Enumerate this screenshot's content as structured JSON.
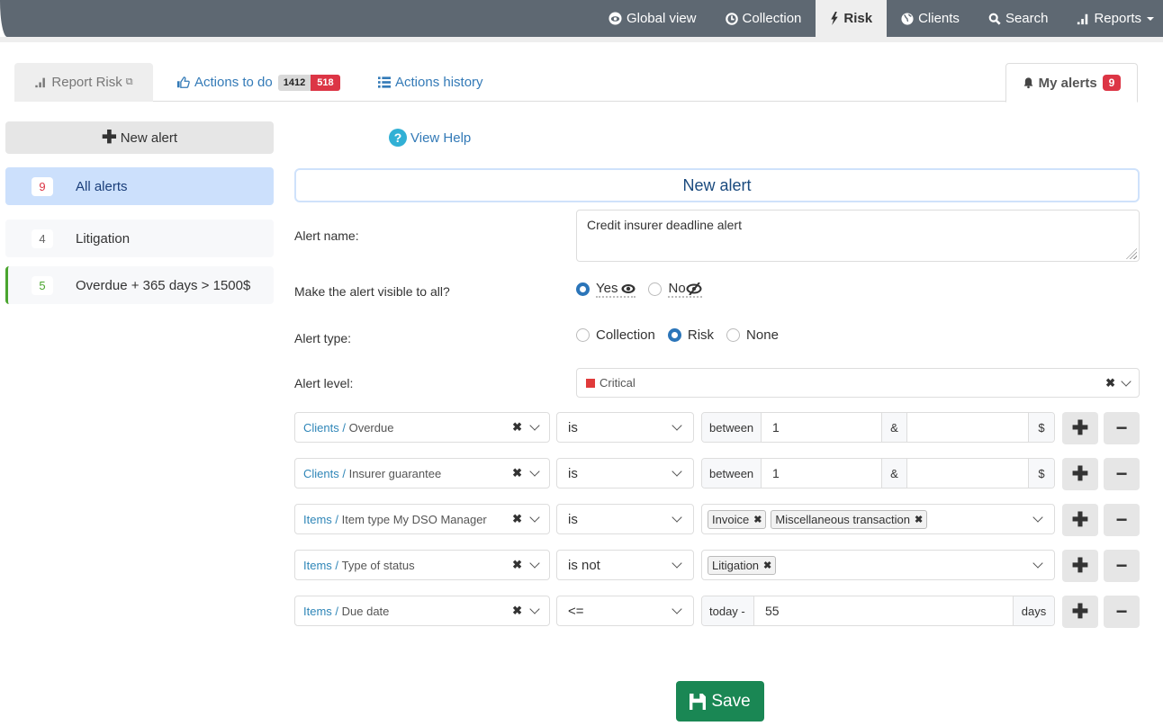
{
  "nav": {
    "items": [
      {
        "label": "Global view",
        "icon": "eye-icon"
      },
      {
        "label": "Collection",
        "icon": "clock-icon"
      },
      {
        "label": "Risk",
        "icon": "bolt-icon",
        "active": true
      },
      {
        "label": "Clients",
        "icon": "globe-icon"
      },
      {
        "label": "Search",
        "icon": "search-icon"
      },
      {
        "label": "Reports",
        "icon": "bar-chart-icon"
      }
    ]
  },
  "tabs": {
    "report_risk": "Report Risk",
    "actions_to_do": "Actions to do",
    "actions_count_total": "1412",
    "actions_count_late": "518",
    "actions_history": "Actions history",
    "my_alerts": "My alerts",
    "my_alerts_count": "9"
  },
  "sidebar": {
    "new_alert": "New alert",
    "items": [
      {
        "count": "9",
        "label": "All alerts",
        "count_color": "#dc3545",
        "active": true
      },
      {
        "count": "4",
        "label": "Litigation",
        "count_color": "#666666"
      },
      {
        "count": "5",
        "label": "Overdue + 365 days > 1500$",
        "count_color": "#4aa52e"
      }
    ]
  },
  "main": {
    "help": "View Help",
    "panel_title": "New alert",
    "alert_name_label": "Alert name:",
    "alert_name_value": "Credit insurer deadline alert",
    "visible_label": "Make the alert visible to all?",
    "visible_options": [
      "Yes",
      "No"
    ],
    "visible_selected": "Yes",
    "type_label": "Alert type:",
    "type_options": [
      "Collection",
      "Risk",
      "None"
    ],
    "type_selected": "Risk",
    "level_label": "Alert level:",
    "level_value": "Critical",
    "level_color": "#e03a3a"
  },
  "criteria": [
    {
      "category": "Clients",
      "field": "Overdue",
      "operator": "is",
      "prefix": "between",
      "from": "1",
      "sep": "&",
      "to": "",
      "suffix": "$"
    },
    {
      "category": "Clients",
      "field": "Insurer guarantee",
      "operator": "is",
      "prefix": "between",
      "from": "1",
      "sep": "&",
      "to": "",
      "suffix": "$"
    },
    {
      "category": "Items",
      "field": "Item type My DSO Manager",
      "operator": "is",
      "tags": [
        "Invoice",
        "Miscellaneous transaction"
      ]
    },
    {
      "category": "Items",
      "field": "Type of status",
      "operator": "is not",
      "tags": [
        "Litigation"
      ]
    },
    {
      "category": "Items",
      "field": "Due date",
      "operator": "<=",
      "prefix": "today -",
      "value": "55",
      "suffix": "days"
    }
  ],
  "save": "Save",
  "colors": {
    "navbar": "#5e6872",
    "accent": "#337ab7",
    "save": "#1a8754",
    "danger": "#dc3545"
  }
}
